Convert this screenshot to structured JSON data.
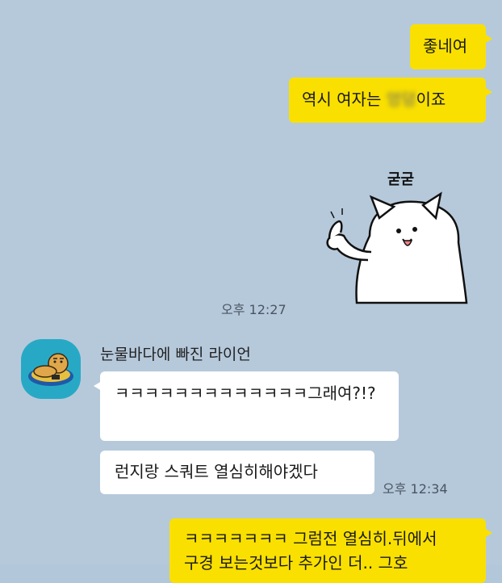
{
  "messages": {
    "m1": "좋네여",
    "m2_before": "역시 여자는 ",
    "m2_blurred": "엉덩",
    "m2_after": "이죠",
    "sticker_text": "굳굳",
    "time1": "오후 12:27",
    "sender_name": "눈물바다에 빠진 라이언",
    "m3": "ㅋㅋㅋㅋㅋㅋㅋㅋㅋㅋㅋㅋㅋ그래여?!?",
    "m4": "런지랑 스쿼트 열심히해야겠다",
    "time2": "오후 12:34",
    "m5_line1": "ㅋㅋㅋㅋㅋㅋㅋ 그럼전 열심히.뒤에서",
    "m5_line2": "구경 보는것보다 추가인 더.. 그호"
  },
  "colors": {
    "background": "#b6c9db",
    "my_bubble": "#f9e000",
    "their_bubble": "#ffffff",
    "avatar_bg": "#27a9c6"
  }
}
